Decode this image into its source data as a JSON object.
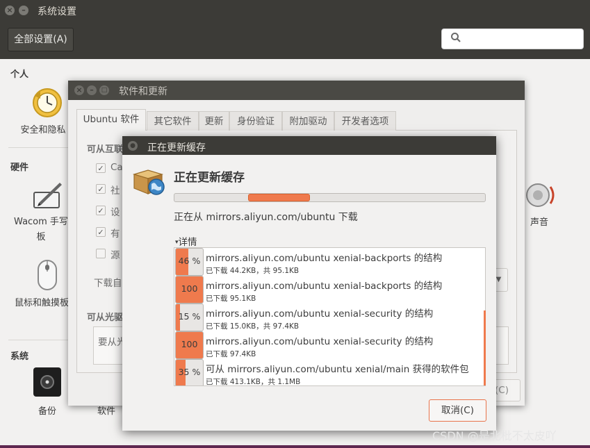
{
  "system_settings": {
    "title": "系统设置",
    "all_settings_label": "全部设置(A)",
    "sections": {
      "personal": "个人",
      "hardware": "硬件",
      "system": "系统"
    },
    "items": {
      "security_privacy": "安全和隐私",
      "wacom": "Wacom 手写板",
      "mouse": "鼠标和触摸板",
      "sound": "声音",
      "backup": "备份",
      "software_partial": "软件"
    }
  },
  "software_updates": {
    "title": "软件和更新",
    "tabs": [
      "Ubuntu 软件",
      "其它软件",
      "更新",
      "身份验证",
      "附加驱动",
      "开发者选项"
    ],
    "internet_section": "可从互联网下载",
    "options": [
      "Ca",
      "社",
      "设",
      "有",
      "源"
    ],
    "download_from": "下载自",
    "cdrom_section": "可从光驱",
    "cdrom_hint": "要从光",
    "revert_partial": "(C)"
  },
  "dialog": {
    "title": "正在更新缓存",
    "heading": "正在更新缓存",
    "status": "正在从 mirrors.aliyun.com/ubuntu 下载",
    "details_label": "详情",
    "rows": [
      {
        "percent_label": "46 %",
        "percent": 46,
        "title": "mirrors.aliyun.com/ubuntu xenial-backports 的结构",
        "sub": "已下载 44.2KB，共 95.1KB"
      },
      {
        "percent_label": "100 %",
        "percent": 100,
        "title": "mirrors.aliyun.com/ubuntu xenial-backports 的结构",
        "sub": "已下载 95.1KB"
      },
      {
        "percent_label": "15 %",
        "percent": 15,
        "title": "mirrors.aliyun.com/ubuntu xenial-security 的结构",
        "sub": "已下载 15.0KB，共 97.4KB"
      },
      {
        "percent_label": "100 %",
        "percent": 100,
        "title": "mirrors.aliyun.com/ubuntu xenial-security 的结构",
        "sub": "已下载 97.4KB"
      },
      {
        "percent_label": "35 %",
        "percent": 35,
        "title": "可从 mirrors.aliyun.com/ubuntu xenial/main 获得的软件包",
        "sub": "已下载 413.1KB，共 1.1MB"
      }
    ],
    "cancel_label": "取消(C)"
  },
  "watermark": "CSDN @是北枇不太皮吖",
  "colors": {
    "accent": "#ef7a4d",
    "titlebar": "#3c3b37",
    "window_bg": "#f2f1f0"
  }
}
